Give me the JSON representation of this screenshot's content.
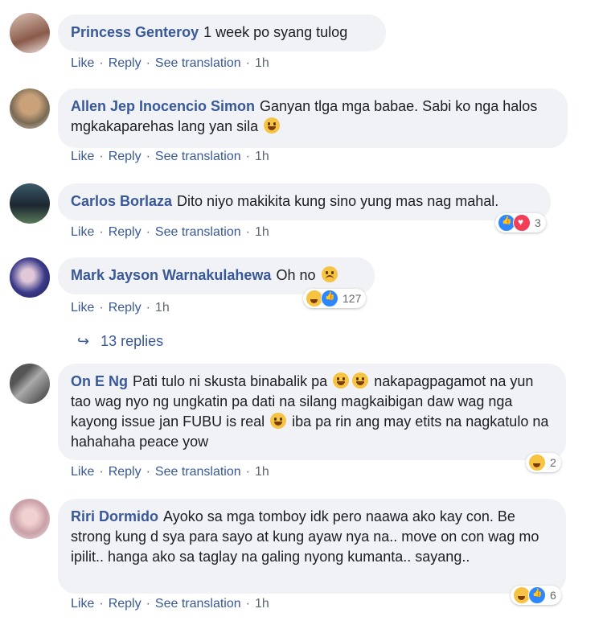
{
  "actions": {
    "like": "Like",
    "reply": "Reply",
    "see_translation": "See translation"
  },
  "comments": [
    {
      "author": "Princess Genteroy",
      "text": "1 week po syang tulog",
      "time": "1h"
    },
    {
      "author": "Allen Jep Inocencio Simon",
      "text": "Ganyan tlga mga babae. Sabi ko nga halos mgkakaparehas lang yan sila",
      "time": "1h"
    },
    {
      "author": "Carlos Borlaza",
      "text": "Dito niyo makikita kung sino yung mas nag mahal.",
      "time": "1h",
      "reaction_count": "3"
    },
    {
      "author": "Mark Jayson Warnakulahewa",
      "text": "Oh no",
      "time": "1h",
      "reaction_count": "127"
    },
    {
      "author": "On E Ng",
      "text": "Pati tulo ni skusta binabalik pa",
      "text2": "nakapagpagamot na yun tao wag nyo ng ungkatin pa dati na silang magkaibigan daw wag nga kayong issue jan FUBU is real",
      "text3": "iba pa rin ang may etits na nagkatulo na hahahaha peace yow",
      "time": "1h",
      "reaction_count": "2"
    },
    {
      "author": "Riri Dormido",
      "text": "Ayoko sa mga tomboy idk pero naawa ako kay con. Be strong kung d sya para sayo at kung ayaw nya na.. move on con wag mo ipilit.. hanga ako sa taglay na galing nyong kumanta.. sayang..",
      "time": "1h",
      "reaction_count": "6"
    }
  ],
  "replies_label": "13 replies",
  "colors": {
    "link": "#385898",
    "bubble": "#f0f2f5",
    "meta": "#606770"
  }
}
